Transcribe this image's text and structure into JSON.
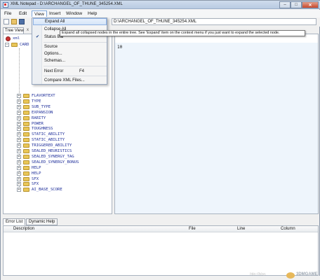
{
  "window": {
    "title": "XML Notepad - D:\\ARCHANGEL_OF_THUNE_345254.XML",
    "buttons": [
      "–",
      "□",
      "✕"
    ]
  },
  "menu": {
    "items": [
      "File",
      "Edit",
      "View",
      "Insert",
      "Window",
      "Help"
    ],
    "open_menu": "View"
  },
  "toolbar": {
    "icons": [
      "new-icon",
      "open-icon",
      "save-icon"
    ],
    "path": "D:\\ARCHANGEL_OF_THUNE_345254.XML"
  },
  "tree": {
    "tab_label": "Tree View",
    "close_label": "x",
    "root_label": "xml",
    "root_child": "CARD",
    "nodes": [
      "FLAVORTEXT",
      "TYPE",
      "SUB_TYPE",
      "EXPANSION",
      "RARITY",
      "POWER",
      "TOUGHNESS",
      "STATIC_ABILITY",
      "STATIC_ABILITY",
      "TRIGGERED_ABILITY",
      "SEALED_HEURISTICS",
      "SEALED_SYNERGY_TAG",
      "SEALED_SYNERGY_BONUS",
      "HELP",
      "HELP",
      "SFX",
      "SFX",
      "AI_BASE_SCORE"
    ]
  },
  "value_pane": {
    "value": "10"
  },
  "view_menu": {
    "items": [
      {
        "label": "Expand All",
        "highlighted": true
      },
      {
        "label": "Collapse All"
      },
      {
        "label": "Status Bar",
        "checked": true
      },
      {
        "label": "Source"
      },
      {
        "label": "Options..."
      },
      {
        "label": "Schemas..."
      },
      {
        "label": "Next Error",
        "shortcut": "F4"
      },
      {
        "label": "Compare XML Files..."
      }
    ],
    "tooltip": "Expand all collapsed nodes in the entire tree. See 'Expand' item on the context menu if you just want to expand the selected node."
  },
  "error_list": {
    "tabs": [
      "Error List",
      "Dynamic Help"
    ],
    "columns": [
      "Description",
      "File",
      "Line",
      "Column"
    ]
  },
  "watermark": {
    "text": "http://blog.",
    "brand": "3DMGAME"
  }
}
